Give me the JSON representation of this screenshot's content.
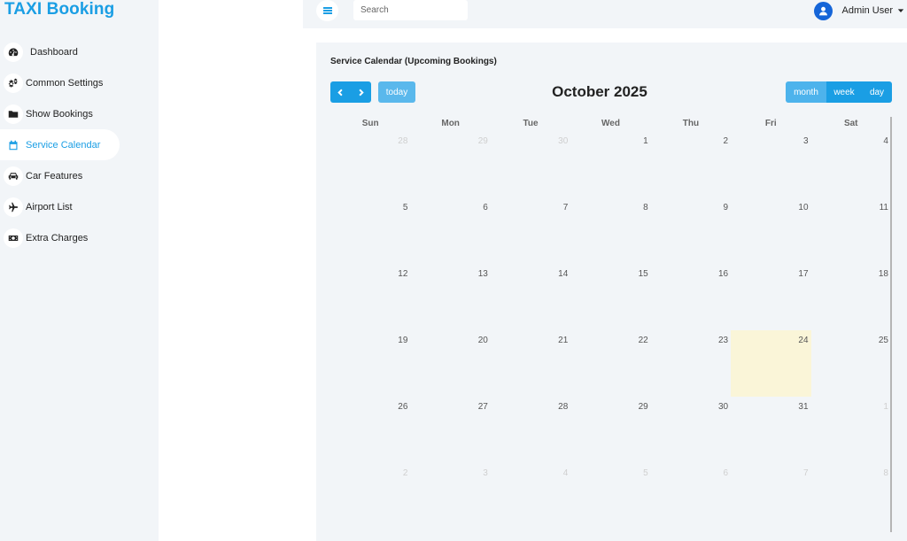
{
  "app": {
    "brand": "TAXI Booking"
  },
  "sidebar": {
    "items": [
      {
        "label": "Dashboard",
        "icon": "gauge-icon",
        "active": false
      },
      {
        "label": "Common Settings",
        "icon": "gears-icon",
        "active": false
      },
      {
        "label": "Show Bookings",
        "icon": "folder-icon",
        "active": false
      },
      {
        "label": "Service Calendar",
        "icon": "calendar-icon",
        "active": true
      },
      {
        "label": "Car Features",
        "icon": "car-icon",
        "active": false
      },
      {
        "label": "Airport List",
        "icon": "plane-icon",
        "active": false
      },
      {
        "label": "Extra Charges",
        "icon": "money-icon",
        "active": false
      }
    ]
  },
  "topbar": {
    "search_placeholder": "Search",
    "user_name": "Admin User"
  },
  "calendar": {
    "panel_title": "Service Calendar (Upcoming Bookings)",
    "month_title": "October 2025",
    "today_label": "today",
    "views": [
      "month",
      "week",
      "day"
    ],
    "active_view": "month",
    "day_headers": [
      "Sun",
      "Mon",
      "Tue",
      "Wed",
      "Thu",
      "Fri",
      "Sat"
    ],
    "today_date": "24",
    "weeks": [
      [
        {
          "d": "28",
          "other": true
        },
        {
          "d": "29",
          "other": true
        },
        {
          "d": "30",
          "other": true
        },
        {
          "d": "1"
        },
        {
          "d": "2"
        },
        {
          "d": "3"
        },
        {
          "d": "4"
        }
      ],
      [
        {
          "d": "5"
        },
        {
          "d": "6"
        },
        {
          "d": "7"
        },
        {
          "d": "8"
        },
        {
          "d": "9"
        },
        {
          "d": "10"
        },
        {
          "d": "11"
        }
      ],
      [
        {
          "d": "12"
        },
        {
          "d": "13"
        },
        {
          "d": "14"
        },
        {
          "d": "15"
        },
        {
          "d": "16"
        },
        {
          "d": "17"
        },
        {
          "d": "18"
        }
      ],
      [
        {
          "d": "19"
        },
        {
          "d": "20"
        },
        {
          "d": "21"
        },
        {
          "d": "22"
        },
        {
          "d": "23"
        },
        {
          "d": "24",
          "today": true
        },
        {
          "d": "25"
        }
      ],
      [
        {
          "d": "26"
        },
        {
          "d": "27"
        },
        {
          "d": "28"
        },
        {
          "d": "29"
        },
        {
          "d": "30"
        },
        {
          "d": "31"
        },
        {
          "d": "1",
          "other": true
        }
      ],
      [
        {
          "d": "2",
          "other": true
        },
        {
          "d": "3",
          "other": true
        },
        {
          "d": "4",
          "other": true
        },
        {
          "d": "5",
          "other": true
        },
        {
          "d": "6",
          "other": true
        },
        {
          "d": "7",
          "other": true
        },
        {
          "d": "8",
          "other": true
        }
      ]
    ]
  },
  "colors": {
    "accent": "#1a9ee4",
    "today_highlight": "#faf5d8",
    "panel_bg": "#f2f5f8"
  }
}
